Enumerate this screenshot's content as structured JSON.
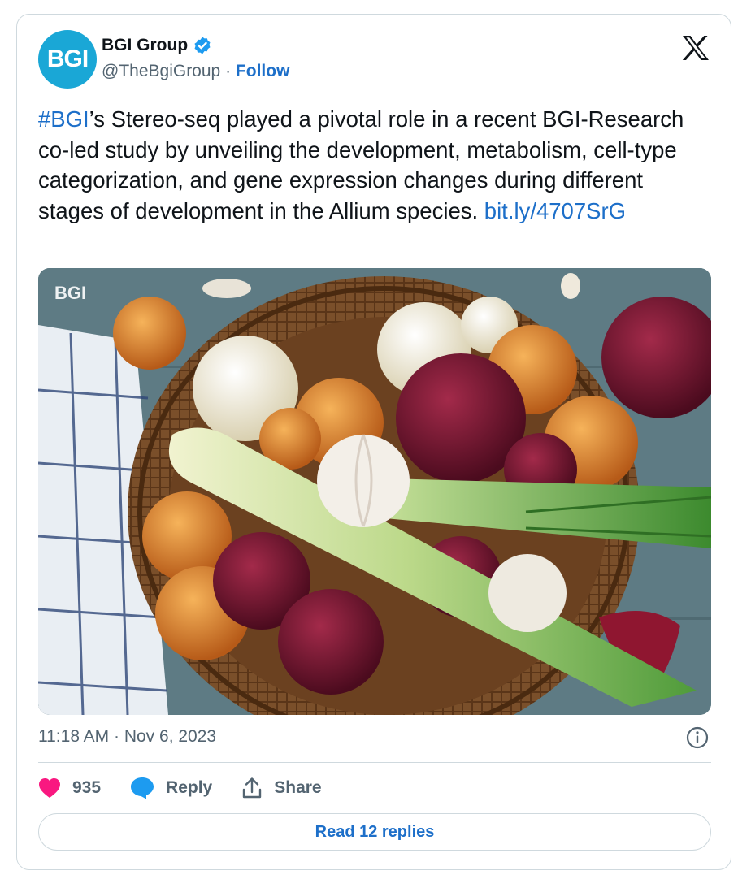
{
  "author": {
    "name": "BGI Group",
    "handle": "@TheBgiGroup",
    "separator": "·",
    "follow_label": "Follow",
    "avatar_text": "BGI"
  },
  "tweet": {
    "hashtag": "#BGI",
    "text": "’s Stereo-seq played a pivotal role in a recent BGI-Research co-led study by unveiling the development, metabolism, cell-type categorization, and gene expression changes during different stages of development in the Allium species. ",
    "link": "bit.ly/4707SrG",
    "image_watermark": "BGI"
  },
  "meta": {
    "timestamp": "11:18 AM · Nov 6, 2023"
  },
  "actions": {
    "like_count": "935",
    "reply_label": "Reply",
    "share_label": "Share"
  },
  "footer": {
    "read_replies_label": "Read 12 replies"
  },
  "colors": {
    "link": "#1d6fc9",
    "like": "#f91880",
    "avatar_bg": "#1aa7d6",
    "verified": "#1d9bf0"
  },
  "icons": [
    "verified-badge-icon",
    "x-logo-icon",
    "info-icon",
    "heart-icon",
    "reply-bubble-icon",
    "share-icon"
  ]
}
